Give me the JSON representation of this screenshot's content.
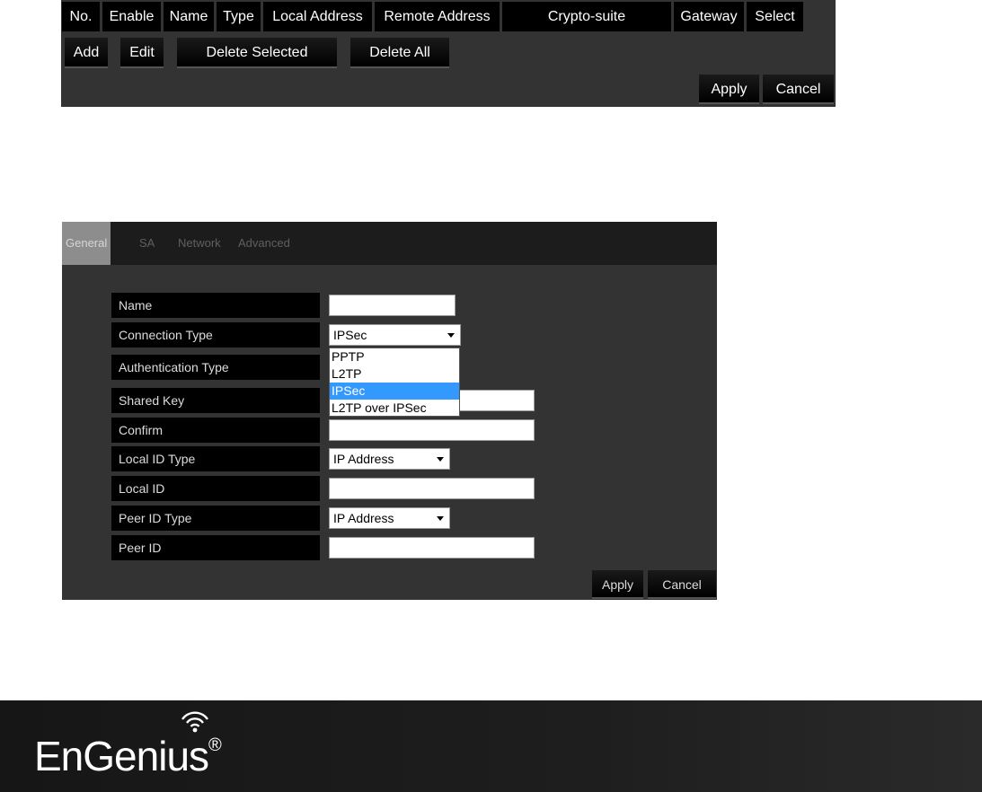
{
  "vpn_list": {
    "columns": [
      "No.",
      "Enable",
      "Name",
      "Type",
      "Local Address",
      "Remote Address",
      "Crypto-suite",
      "Gateway",
      "Select"
    ],
    "buttons": {
      "add": "Add",
      "edit": "Edit",
      "delete_selected": "Delete Selected",
      "delete_all": "Delete All",
      "apply": "Apply",
      "cancel": "Cancel"
    }
  },
  "ipsec_form": {
    "tabs": [
      "General",
      "SA",
      "Network",
      "Advanced"
    ],
    "active_tab": "General",
    "fields": {
      "name": {
        "label": "Name",
        "value": ""
      },
      "connection_type": {
        "label": "Connection Type",
        "value": "IPSec"
      },
      "authentication_type": {
        "label": "Authentication Type"
      },
      "shared_key": {
        "label": "Shared Key",
        "value": ""
      },
      "confirm": {
        "label": "Confirm",
        "value": ""
      },
      "local_id_type": {
        "label": "Local ID Type",
        "value": "IP Address"
      },
      "local_id": {
        "label": "Local ID",
        "value": ""
      },
      "peer_id_type": {
        "label": "Peer ID Type",
        "value": "IP Address"
      },
      "peer_id": {
        "label": "Peer ID",
        "value": ""
      }
    },
    "connection_type_options": [
      "PPTP",
      "L2TP",
      "IPSec",
      "L2TP over IPSec"
    ],
    "highlighted_option": "IPSec",
    "buttons": {
      "apply": "Apply",
      "cancel": "Cancel"
    }
  },
  "footer": {
    "brand": "EnGenius",
    "brand_part1": "EnGen",
    "brand_part2": "us",
    "registered": "®",
    "icon": "wifi-signal-icon"
  },
  "colors": {
    "panel_bg": "#333333",
    "header_bg": "#000000",
    "highlight": "#3399ff",
    "footer_bg": "#1e1e1e"
  }
}
